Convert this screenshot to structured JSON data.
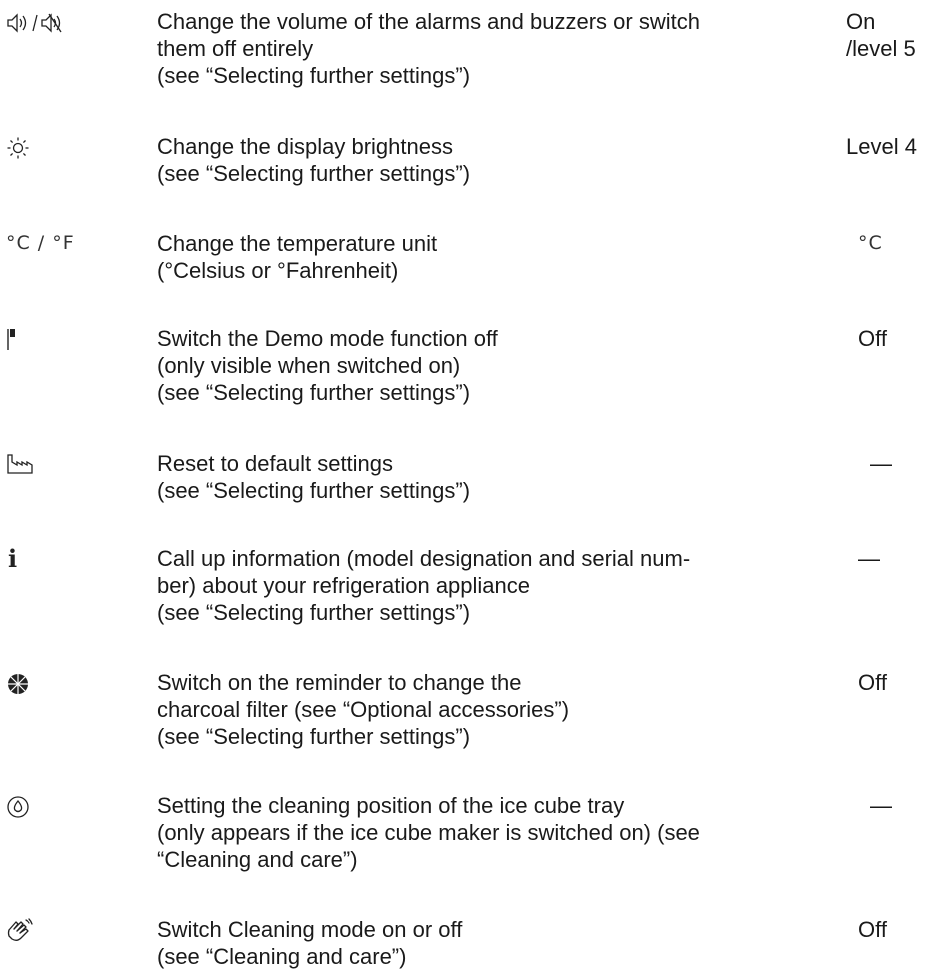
{
  "settings": [
    {
      "icon": "volume-icon",
      "symbol_text": "",
      "lines": [
        "Change the volume of the alarms and buzzers or switch",
        "them off entirely",
        "(see “Selecting further settings”)"
      ],
      "value_lines": [
        "On",
        "/level 5"
      ]
    },
    {
      "icon": "brightness-icon",
      "symbol_text": "",
      "lines": [
        "Change the display brightness",
        "(see “Selecting further settings”)"
      ],
      "value_lines": [
        "Level 4"
      ]
    },
    {
      "icon": "temperature-unit-icon",
      "symbol_text": "°C / °F",
      "lines": [
        "Change the temperature unit",
        "(°Celsius or °Fahrenheit)"
      ],
      "value_lines": [
        "°C"
      ]
    },
    {
      "icon": "demo-mode-flag-icon",
      "symbol_text": "",
      "lines": [
        "Switch the Demo mode function off",
        "(only visible when switched on)",
        "(see “Selecting further settings”)"
      ],
      "value_lines": [
        "Off"
      ]
    },
    {
      "icon": "factory-reset-icon",
      "symbol_text": "",
      "lines": [
        "Reset to default settings",
        "(see “Selecting further settings”)"
      ],
      "value_lines": [
        "—"
      ]
    },
    {
      "icon": "info-icon",
      "symbol_text": "i",
      "lines": [
        "Call up information (model designation and serial num-",
        "ber) about your refrigeration appliance",
        "(see “Selecting further settings”)"
      ],
      "value_lines": [
        "—"
      ]
    },
    {
      "icon": "charcoal-filter-icon",
      "symbol_text": "",
      "lines": [
        "Switch on the reminder to change the",
        "charcoal filter (see “Optional accessories”)",
        "(see “Selecting further settings”)"
      ],
      "value_lines": [
        "Off"
      ]
    },
    {
      "icon": "ice-tray-cleaning-icon",
      "symbol_text": "",
      "lines": [
        "Setting the cleaning position of the ice cube tray",
        "(only appears if the ice cube maker is switched on) (see",
        "“Cleaning and care”)"
      ],
      "value_lines": [
        "—"
      ]
    },
    {
      "icon": "cleaning-mode-hand-icon",
      "symbol_text": "",
      "lines": [
        "Switch Cleaning mode on or off",
        "(see “Cleaning and care”)"
      ],
      "value_lines": [
        "Off"
      ]
    }
  ]
}
